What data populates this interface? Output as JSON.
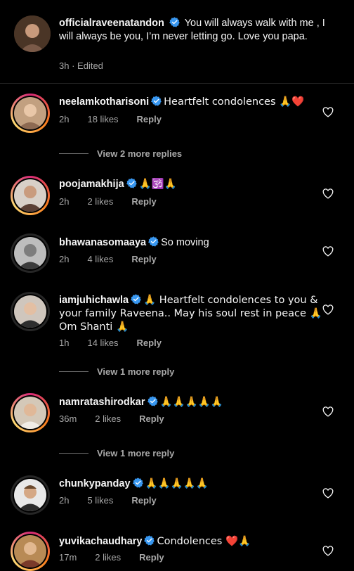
{
  "caption": {
    "username": "officialraveenatandon",
    "text": "You will always walk with me , I will always be you, I’m never letting go. Love you papa.",
    "time": "3h",
    "edited": "Edited"
  },
  "comments": [
    {
      "username": "neelamkotharisoni",
      "text": "Heartfelt condolences 🙏❤️",
      "time": "2h",
      "likes": "18 likes",
      "reply": "Reply"
    },
    {
      "username": "poojamakhija",
      "text": "🙏🕉️🙏",
      "time": "2h",
      "likes": "2 likes",
      "reply": "Reply"
    },
    {
      "username": "bhawanasomaaya",
      "text": "So moving",
      "time": "2h",
      "likes": "4 likes",
      "reply": "Reply"
    },
    {
      "username": "iamjuhichawla",
      "text": "🙏 Heartfelt condolences to you & your family Raveena.. May his soul rest in peace 🙏Om Shanti 🙏",
      "time": "1h",
      "likes": "14 likes",
      "reply": "Reply"
    },
    {
      "username": "namratashirodkar",
      "text": "🙏🙏🙏🙏🙏",
      "time": "36m",
      "likes": "2 likes",
      "reply": "Reply"
    },
    {
      "username": "chunkypanday",
      "text": "🙏🙏🙏🙏🙏",
      "time": "2h",
      "likes": "5 likes",
      "reply": "Reply"
    },
    {
      "username": "yuvikachaudhary",
      "text": "Condolences ❤️🙏",
      "time": "17m",
      "likes": "2 likes",
      "reply": "Reply"
    }
  ],
  "view_more": [
    "View 2 more replies",
    "View 1 more reply",
    "View 1 more reply"
  ],
  "colors": {
    "background": "#000000",
    "verified_blue": "#3897f0",
    "secondary_text": "#a8a8a8",
    "story_ring": "#d62976"
  },
  "icons": {
    "verified": "verified-badge-icon",
    "like": "heart-outline-icon"
  }
}
